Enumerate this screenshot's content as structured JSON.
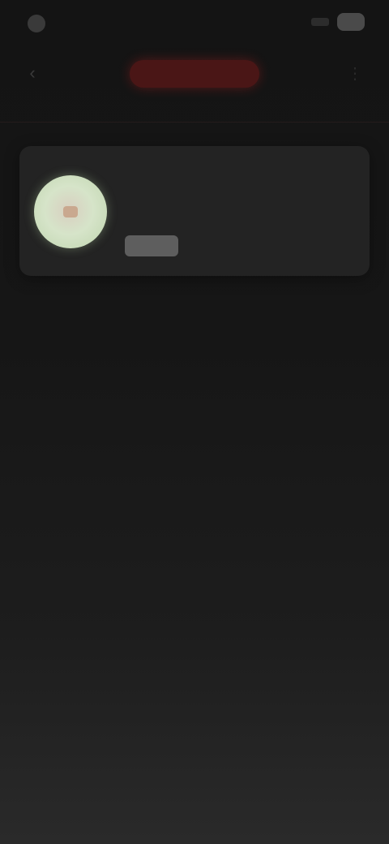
{
  "status_bar": {
    "time": ""
  },
  "header": {
    "back_icon": "back-arrow-icon",
    "title": "",
    "title_color": "#b02c2c",
    "more_icon": "more-icon"
  },
  "card": {
    "title": "",
    "subtitle": "",
    "chip_label": "",
    "avatar_color": "#d6e4c9"
  }
}
